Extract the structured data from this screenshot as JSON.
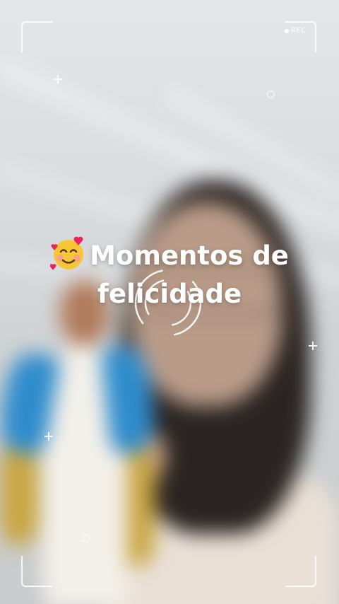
{
  "recording_indicator": {
    "label": "REC"
  },
  "caption": {
    "emoji": "smiling-face-with-hearts-icon",
    "line1": "Momentos de",
    "line2": "felicidade"
  },
  "colors": {
    "frame_white": "#ffffff",
    "background_grey": "#d8dbde",
    "mantle_blue": "#2f8ccc",
    "gold": "#c9a642"
  }
}
